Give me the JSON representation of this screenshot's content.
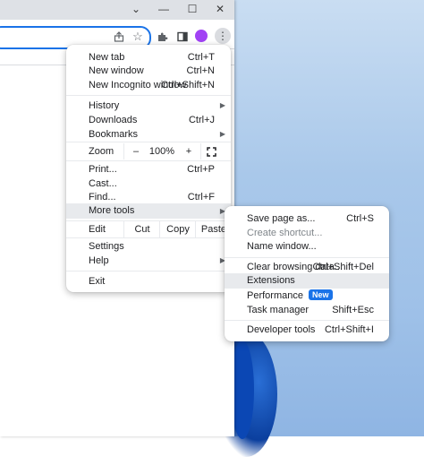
{
  "titlebar": {
    "chevron": "⌄",
    "minimize": "—",
    "maximize": "☐",
    "close": "✕"
  },
  "main_menu": {
    "new_tab": {
      "label": "New tab",
      "shortcut": "Ctrl+T"
    },
    "new_window": {
      "label": "New window",
      "shortcut": "Ctrl+N"
    },
    "new_incognito": {
      "label": "New Incognito window",
      "shortcut": "Ctrl+Shift+N"
    },
    "history": {
      "label": "History"
    },
    "downloads": {
      "label": "Downloads",
      "shortcut": "Ctrl+J"
    },
    "bookmarks": {
      "label": "Bookmarks"
    },
    "zoom": {
      "label": "Zoom",
      "minus": "–",
      "value": "100%",
      "plus": "+"
    },
    "print": {
      "label": "Print...",
      "shortcut": "Ctrl+P"
    },
    "cast": {
      "label": "Cast..."
    },
    "find": {
      "label": "Find...",
      "shortcut": "Ctrl+F"
    },
    "more_tools": {
      "label": "More tools"
    },
    "edit": {
      "label": "Edit",
      "cut": "Cut",
      "copy": "Copy",
      "paste": "Paste"
    },
    "settings": {
      "label": "Settings"
    },
    "help": {
      "label": "Help"
    },
    "exit": {
      "label": "Exit"
    }
  },
  "submenu": {
    "save_page": {
      "label": "Save page as...",
      "shortcut": "Ctrl+S"
    },
    "create_shortcut": {
      "label": "Create shortcut..."
    },
    "name_window": {
      "label": "Name window..."
    },
    "clear_browsing": {
      "label": "Clear browsing data...",
      "shortcut": "Ctrl+Shift+Del"
    },
    "extensions": {
      "label": "Extensions"
    },
    "performance": {
      "label": "Performance",
      "badge": "New"
    },
    "task_manager": {
      "label": "Task manager",
      "shortcut": "Shift+Esc"
    },
    "developer_tools": {
      "label": "Developer tools",
      "shortcut": "Ctrl+Shift+I"
    }
  },
  "colors": {
    "accent": "#1a73e8",
    "avatar": "#a142f4",
    "highlight": "#e8eaed"
  }
}
